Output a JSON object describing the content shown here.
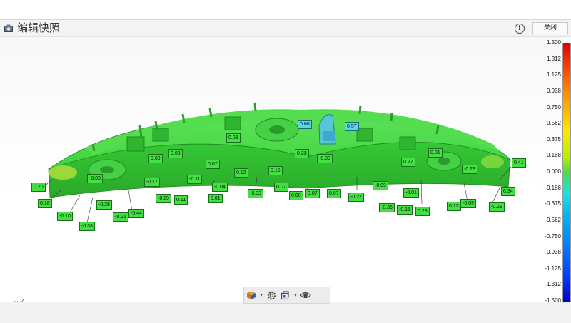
{
  "window": {
    "title": "编辑快照",
    "close_label": "关闭"
  },
  "colorbar": {
    "ticks": [
      "1.500",
      "1.312",
      "1.125",
      "0.938",
      "0.750",
      "0.562",
      "0.375",
      "0.188",
      "0.000",
      "-0.188",
      "-0.375",
      "-0.562",
      "-0.750",
      "-0.938",
      "-1.125",
      "-1.312",
      "-1.500"
    ],
    "colors": {
      "max": "#e60000",
      "mid": "#4cd94c",
      "min": "#0000c8"
    }
  },
  "axes": {
    "x": "X",
    "y": "Y",
    "z": "Z"
  },
  "deviation_labels": [
    "0.20",
    "0.18",
    "-0.10",
    "-0.33",
    "-0.03",
    "-0.28",
    "-0.21",
    "-0.44",
    "0.09",
    "0.03",
    "-0.17",
    "-0.29",
    "0.11",
    "-0.11",
    "0.07",
    "-0.04",
    "0.01",
    "0.08",
    "0.12",
    "-0.03",
    "0.15",
    "0.07",
    "0.08",
    "0.60",
    "0.07",
    "0.23",
    "0.57",
    "-0.09",
    "0.07",
    "-0.22",
    "-0.09",
    "-0.35",
    "-0.15",
    "-0.01",
    "0.28",
    "0.27",
    "0.01",
    "-0.23",
    "0.13",
    "-0.09",
    "0.41",
    "0.34",
    "-0.29"
  ],
  "toolbar": {
    "items": [
      "display-mode-icon",
      "settings-icon",
      "clip-icon",
      "visibility-icon"
    ]
  }
}
